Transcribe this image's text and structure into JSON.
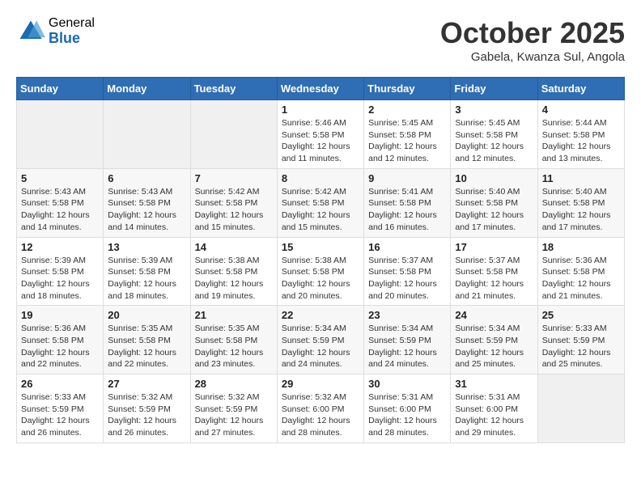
{
  "header": {
    "logo_general": "General",
    "logo_blue": "Blue",
    "month_title": "October 2025",
    "location": "Gabela, Kwanza Sul, Angola"
  },
  "weekdays": [
    "Sunday",
    "Monday",
    "Tuesday",
    "Wednesday",
    "Thursday",
    "Friday",
    "Saturday"
  ],
  "weeks": [
    [
      {
        "day": "",
        "info": ""
      },
      {
        "day": "",
        "info": ""
      },
      {
        "day": "",
        "info": ""
      },
      {
        "day": "1",
        "info": "Sunrise: 5:46 AM\nSunset: 5:58 PM\nDaylight: 12 hours and 11 minutes."
      },
      {
        "day": "2",
        "info": "Sunrise: 5:45 AM\nSunset: 5:58 PM\nDaylight: 12 hours and 12 minutes."
      },
      {
        "day": "3",
        "info": "Sunrise: 5:45 AM\nSunset: 5:58 PM\nDaylight: 12 hours and 12 minutes."
      },
      {
        "day": "4",
        "info": "Sunrise: 5:44 AM\nSunset: 5:58 PM\nDaylight: 12 hours and 13 minutes."
      }
    ],
    [
      {
        "day": "5",
        "info": "Sunrise: 5:43 AM\nSunset: 5:58 PM\nDaylight: 12 hours and 14 minutes."
      },
      {
        "day": "6",
        "info": "Sunrise: 5:43 AM\nSunset: 5:58 PM\nDaylight: 12 hours and 14 minutes."
      },
      {
        "day": "7",
        "info": "Sunrise: 5:42 AM\nSunset: 5:58 PM\nDaylight: 12 hours and 15 minutes."
      },
      {
        "day": "8",
        "info": "Sunrise: 5:42 AM\nSunset: 5:58 PM\nDaylight: 12 hours and 15 minutes."
      },
      {
        "day": "9",
        "info": "Sunrise: 5:41 AM\nSunset: 5:58 PM\nDaylight: 12 hours and 16 minutes."
      },
      {
        "day": "10",
        "info": "Sunrise: 5:40 AM\nSunset: 5:58 PM\nDaylight: 12 hours and 17 minutes."
      },
      {
        "day": "11",
        "info": "Sunrise: 5:40 AM\nSunset: 5:58 PM\nDaylight: 12 hours and 17 minutes."
      }
    ],
    [
      {
        "day": "12",
        "info": "Sunrise: 5:39 AM\nSunset: 5:58 PM\nDaylight: 12 hours and 18 minutes."
      },
      {
        "day": "13",
        "info": "Sunrise: 5:39 AM\nSunset: 5:58 PM\nDaylight: 12 hours and 18 minutes."
      },
      {
        "day": "14",
        "info": "Sunrise: 5:38 AM\nSunset: 5:58 PM\nDaylight: 12 hours and 19 minutes."
      },
      {
        "day": "15",
        "info": "Sunrise: 5:38 AM\nSunset: 5:58 PM\nDaylight: 12 hours and 20 minutes."
      },
      {
        "day": "16",
        "info": "Sunrise: 5:37 AM\nSunset: 5:58 PM\nDaylight: 12 hours and 20 minutes."
      },
      {
        "day": "17",
        "info": "Sunrise: 5:37 AM\nSunset: 5:58 PM\nDaylight: 12 hours and 21 minutes."
      },
      {
        "day": "18",
        "info": "Sunrise: 5:36 AM\nSunset: 5:58 PM\nDaylight: 12 hours and 21 minutes."
      }
    ],
    [
      {
        "day": "19",
        "info": "Sunrise: 5:36 AM\nSunset: 5:58 PM\nDaylight: 12 hours and 22 minutes."
      },
      {
        "day": "20",
        "info": "Sunrise: 5:35 AM\nSunset: 5:58 PM\nDaylight: 12 hours and 22 minutes."
      },
      {
        "day": "21",
        "info": "Sunrise: 5:35 AM\nSunset: 5:58 PM\nDaylight: 12 hours and 23 minutes."
      },
      {
        "day": "22",
        "info": "Sunrise: 5:34 AM\nSunset: 5:59 PM\nDaylight: 12 hours and 24 minutes."
      },
      {
        "day": "23",
        "info": "Sunrise: 5:34 AM\nSunset: 5:59 PM\nDaylight: 12 hours and 24 minutes."
      },
      {
        "day": "24",
        "info": "Sunrise: 5:34 AM\nSunset: 5:59 PM\nDaylight: 12 hours and 25 minutes."
      },
      {
        "day": "25",
        "info": "Sunrise: 5:33 AM\nSunset: 5:59 PM\nDaylight: 12 hours and 25 minutes."
      }
    ],
    [
      {
        "day": "26",
        "info": "Sunrise: 5:33 AM\nSunset: 5:59 PM\nDaylight: 12 hours and 26 minutes."
      },
      {
        "day": "27",
        "info": "Sunrise: 5:32 AM\nSunset: 5:59 PM\nDaylight: 12 hours and 26 minutes."
      },
      {
        "day": "28",
        "info": "Sunrise: 5:32 AM\nSunset: 5:59 PM\nDaylight: 12 hours and 27 minutes."
      },
      {
        "day": "29",
        "info": "Sunrise: 5:32 AM\nSunset: 6:00 PM\nDaylight: 12 hours and 28 minutes."
      },
      {
        "day": "30",
        "info": "Sunrise: 5:31 AM\nSunset: 6:00 PM\nDaylight: 12 hours and 28 minutes."
      },
      {
        "day": "31",
        "info": "Sunrise: 5:31 AM\nSunset: 6:00 PM\nDaylight: 12 hours and 29 minutes."
      },
      {
        "day": "",
        "info": ""
      }
    ]
  ]
}
